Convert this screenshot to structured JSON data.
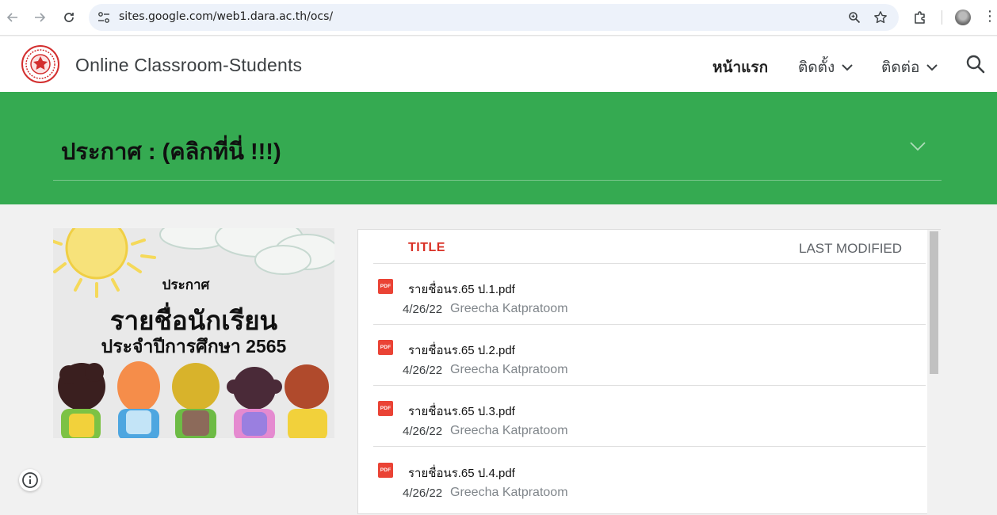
{
  "browser": {
    "url": "sites.google.com/web1.dara.ac.th/ocs/",
    "icons": [
      "back-icon",
      "forward-icon",
      "reload-icon",
      "site-settings-icon",
      "zoom-icon",
      "bookmark-star-icon",
      "extensions-icon",
      "profile-avatar",
      "menu-kebab-icon"
    ]
  },
  "site": {
    "title": "Online Classroom-Students",
    "nav": [
      {
        "label": "หน้าแรก",
        "active": true
      },
      {
        "label": "ติดตั้ง",
        "dropdown": true
      },
      {
        "label": "ติดต่อ",
        "dropdown": true
      }
    ]
  },
  "banner": {
    "title": "ประกาศ  : (คลิกที่นี่ !!!)"
  },
  "poster": {
    "line1": "ประกาศ",
    "line2": "รายชื่อนักเรียน",
    "line3": "ประจำปีการศึกษา 2565"
  },
  "files": {
    "col_title": "TITLE",
    "col_modified": "LAST MODIFIED",
    "icon_label": "PDF",
    "rows": [
      {
        "name": "รายชื่อนร.65 ป.1.pdf",
        "date": "4/26/22",
        "author": "Greecha Katpratoom"
      },
      {
        "name": "รายชื่อนร.65 ป.2.pdf",
        "date": "4/26/22",
        "author": "Greecha Katpratoom"
      },
      {
        "name": "รายชื่อนร.65 ป.3.pdf",
        "date": "4/26/22",
        "author": "Greecha Katpratoom"
      },
      {
        "name": "รายชื่อนร.65 ป.4.pdf",
        "date": "4/26/22",
        "author": "Greecha Katpratoom"
      }
    ]
  },
  "colors": {
    "banner_green": "#35aa51",
    "title_red": "#d93025",
    "pdf_red": "#ea4335"
  }
}
